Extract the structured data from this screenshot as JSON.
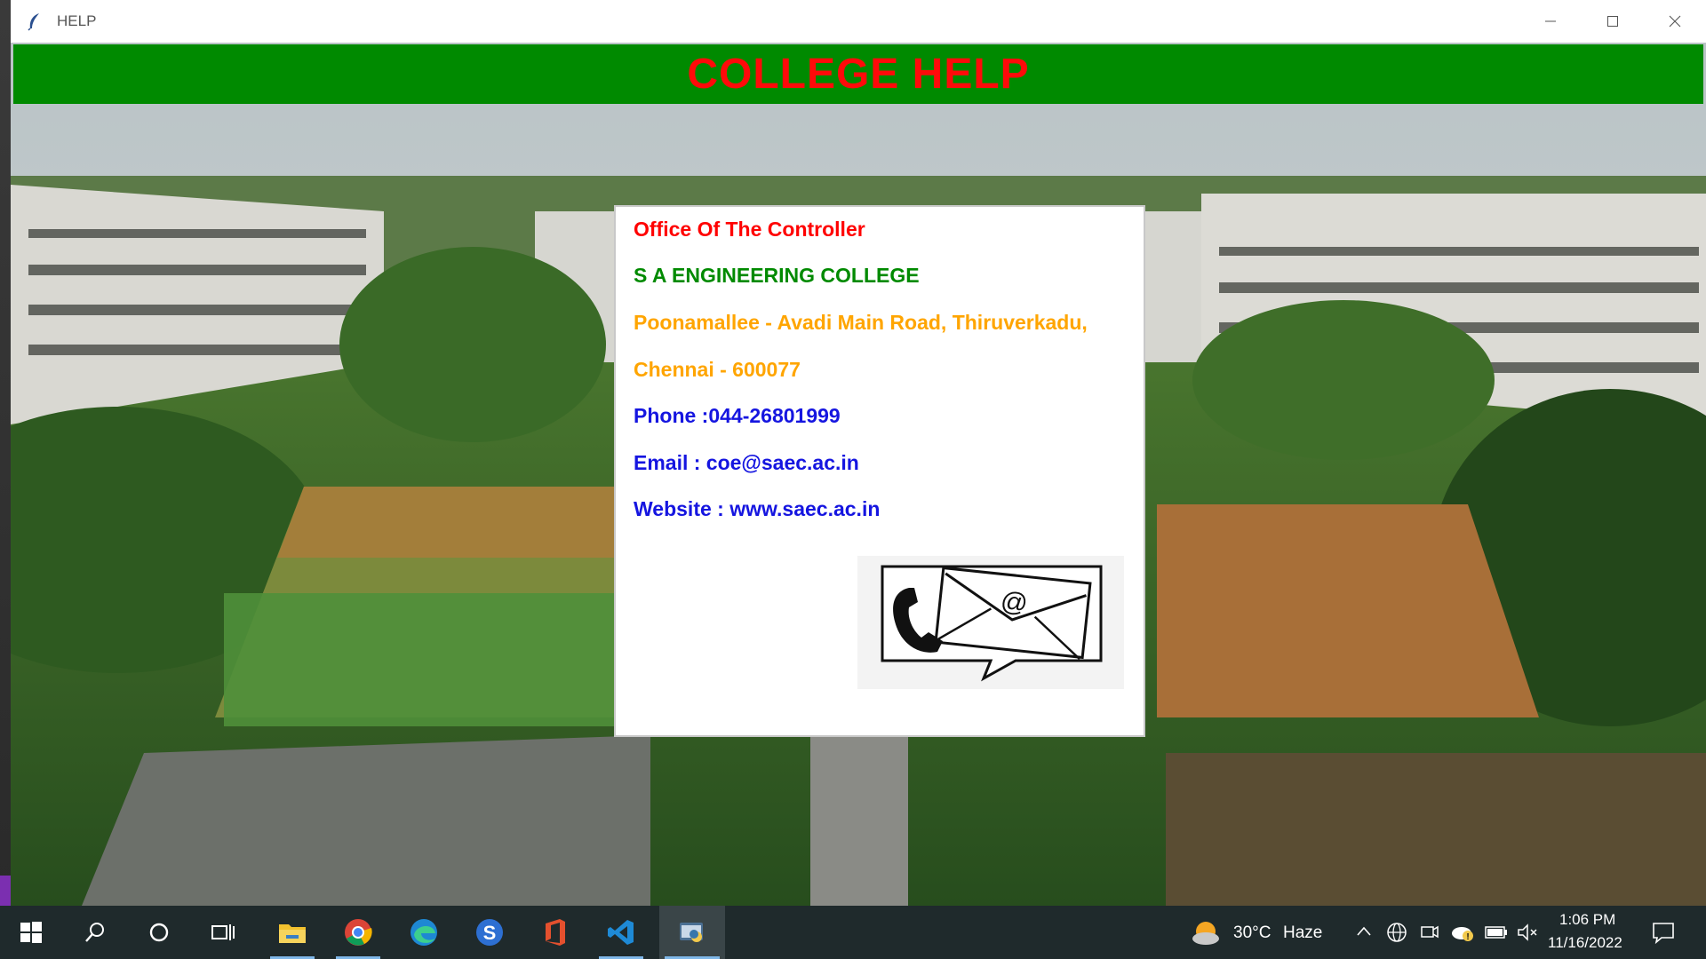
{
  "window": {
    "title": "HELP",
    "controls": {
      "minimize": "—",
      "maximize": "☐",
      "close": "✕"
    }
  },
  "header": {
    "title": "COLLEGE HELP",
    "bg_color": "#008a00",
    "text_color": "#ff0a0a"
  },
  "info": {
    "lines": [
      {
        "text": "Office Of The Controller",
        "color": "#ff0000"
      },
      {
        "text": "S A ENGINEERING COLLEGE",
        "color": "#008a00"
      },
      {
        "text": "Poonamallee - Avadi Main Road, Thiruverkadu,",
        "color": "#ffa500"
      },
      {
        "text": "Chennai - 600077",
        "color": "#ffa500"
      },
      {
        "text": "Phone :044-26801999",
        "color": "#1515e0"
      },
      {
        "text": "Email : coe@saec.ac.in",
        "color": "#1515e0"
      },
      {
        "text": "Website : www.saec.ac.in",
        "color": "#1515e0"
      }
    ],
    "image_icon": "phone-envelope-contact-icon"
  },
  "taskbar": {
    "apps": [
      "start-icon",
      "search-icon",
      "cortana-icon",
      "task-view-icon",
      "file-explorer-icon",
      "chrome-icon",
      "edge-icon",
      "simplenote-icon",
      "office-icon",
      "vscode-icon",
      "python-idle-icon"
    ],
    "weather": {
      "temp": "30°C",
      "condition": "Haze"
    },
    "time": "1:06 PM",
    "date": "11/16/2022"
  }
}
